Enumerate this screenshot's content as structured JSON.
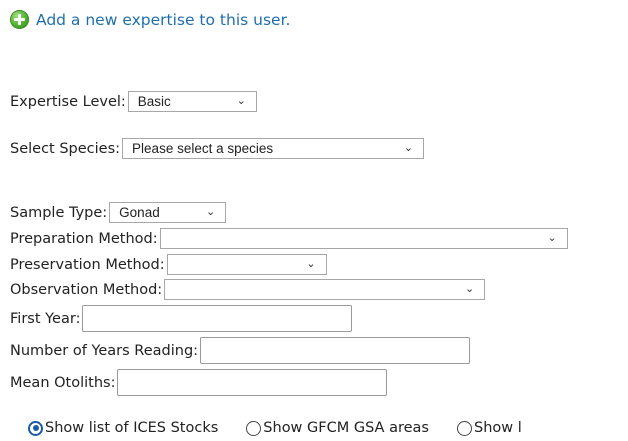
{
  "add_link": {
    "icon": "plus-circle-icon",
    "text": "Add a new expertise to this user."
  },
  "form": {
    "expertise_level": {
      "label": "Expertise Level:",
      "value": "Basic"
    },
    "species": {
      "label": "Select Species:",
      "value": "Please select a species"
    },
    "sample_type": {
      "label": "Sample Type:",
      "value": "Gonad"
    },
    "preparation_method": {
      "label": "Preparation Method:",
      "value": ""
    },
    "preservation_method": {
      "label": "Preservation Method:",
      "value": ""
    },
    "observation_method": {
      "label": "Observation Method:",
      "value": ""
    },
    "first_year": {
      "label": "First Year:",
      "value": ""
    },
    "years_reading": {
      "label": "Number of Years Reading:",
      "value": ""
    },
    "mean_otoliths": {
      "label": "Mean Otoliths:",
      "value": ""
    }
  },
  "radios": [
    {
      "label": "Show list of ICES Stocks",
      "checked": true
    },
    {
      "label": "Show GFCM GSA areas",
      "checked": false
    },
    {
      "label": "Show l",
      "checked": false
    }
  ],
  "chevron": "⌄",
  "colors": {
    "link": "#1f6fae",
    "radio_selected": "#1a5aa8",
    "icon_green": "#4cae2f"
  }
}
